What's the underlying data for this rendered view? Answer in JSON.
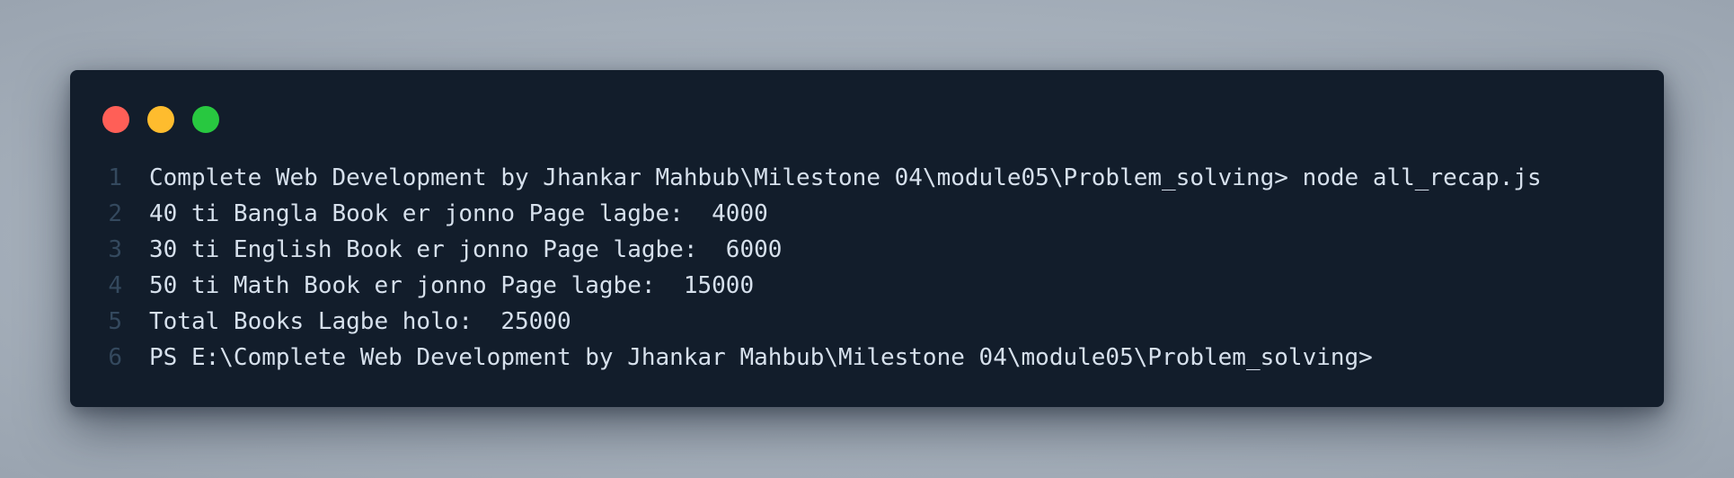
{
  "window_controls": [
    "close",
    "minimize",
    "maximize"
  ],
  "colors": {
    "close": "#ff5f57",
    "minimize": "#febc2e",
    "maximize": "#28c840",
    "editor_background": "#121d2b",
    "line_number": "#34495e",
    "text": "#d6e0ec"
  },
  "lines": [
    {
      "number": "1",
      "text": "Complete Web Development by Jhankar Mahbub\\Milestone 04\\module05\\Problem_solving> node all_recap.js"
    },
    {
      "number": "2",
      "text": "40 ti Bangla Book er jonno Page lagbe:  4000"
    },
    {
      "number": "3",
      "text": "30 ti English Book er jonno Page lagbe:  6000"
    },
    {
      "number": "4",
      "text": "50 ti Math Book er jonno Page lagbe:  15000"
    },
    {
      "number": "5",
      "text": "Total Books Lagbe holo:  25000"
    },
    {
      "number": "6",
      "text": "PS E:\\Complete Web Development by Jhankar Mahbub\\Milestone 04\\module05\\Problem_solving>"
    }
  ]
}
